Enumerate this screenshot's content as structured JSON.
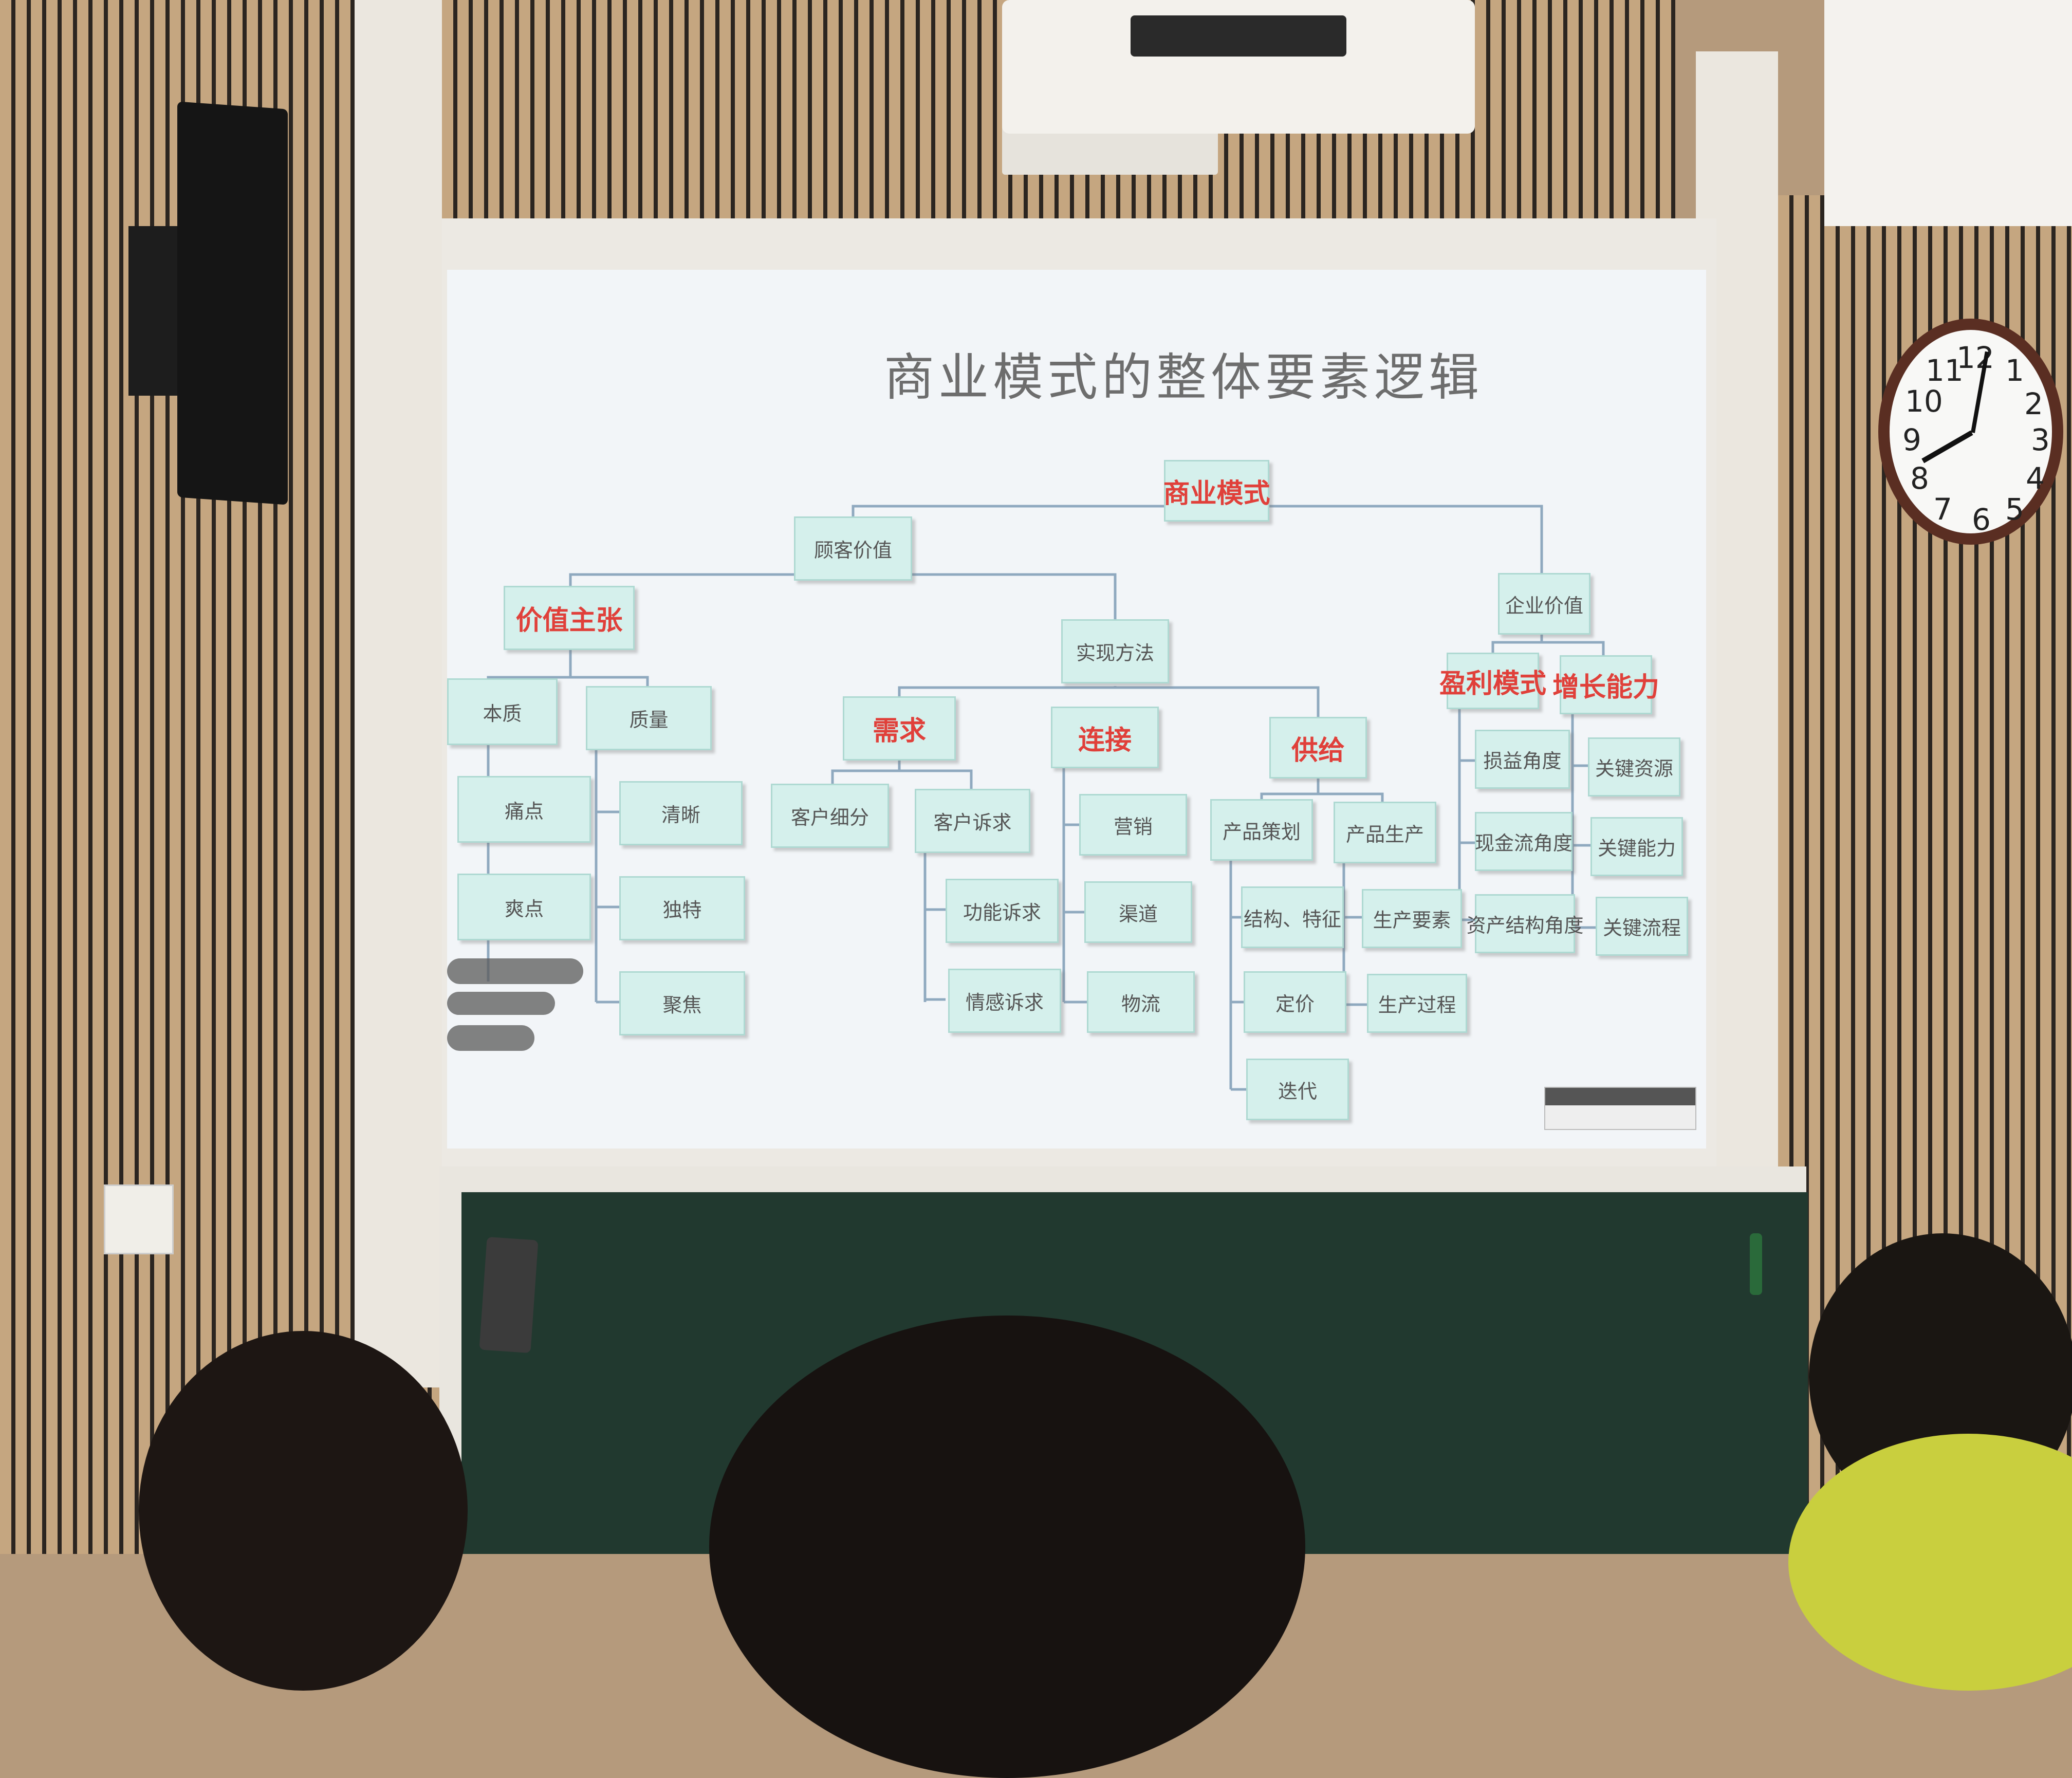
{
  "slide": {
    "title": "商业模式的整体要素逻辑",
    "nodes": {
      "root": "商业模式",
      "customer_value": "顾客价值",
      "enterprise_value": "企业价值",
      "value_proposition": "价值主张",
      "implementation": "实现方法",
      "profit_model": "盈利模式",
      "growth_ability": "增长能力",
      "essence": "本质",
      "quality": "质量",
      "pain_point": "痛点",
      "delight_point": "爽点",
      "clear": "清晰",
      "unique": "独特",
      "focus": "聚焦",
      "demand": "需求",
      "connection": "连接",
      "supply": "供给",
      "customer_segment": "客户细分",
      "customer_appeal": "客户诉求",
      "functional_appeal": "功能诉求",
      "emotional_appeal": "情感诉求",
      "marketing": "营销",
      "channel": "渠道",
      "logistics": "物流",
      "product_planning": "产品策划",
      "product_production": "产品生产",
      "structure_features": "结构、特征",
      "pricing": "定价",
      "iteration": "迭代",
      "production_factors": "生产要素",
      "production_process": "生产过程",
      "profit_loss_angle": "损益角度",
      "cash_flow_angle": "现金流角度",
      "capital_structure_angle": "资产结构角度",
      "key_resources": "关键资源",
      "key_capabilities": "关键能力",
      "key_processes": "关键流程"
    }
  },
  "clock": {
    "numbers": [
      "12",
      "1",
      "2",
      "3",
      "4",
      "5",
      "6",
      "7",
      "8",
      "9",
      "10",
      "11"
    ]
  },
  "colors": {
    "node_fill": "#d5f0ec",
    "node_border": "#aed9d2",
    "highlight_text": "#e0403a",
    "line": "#8fa9bf"
  }
}
